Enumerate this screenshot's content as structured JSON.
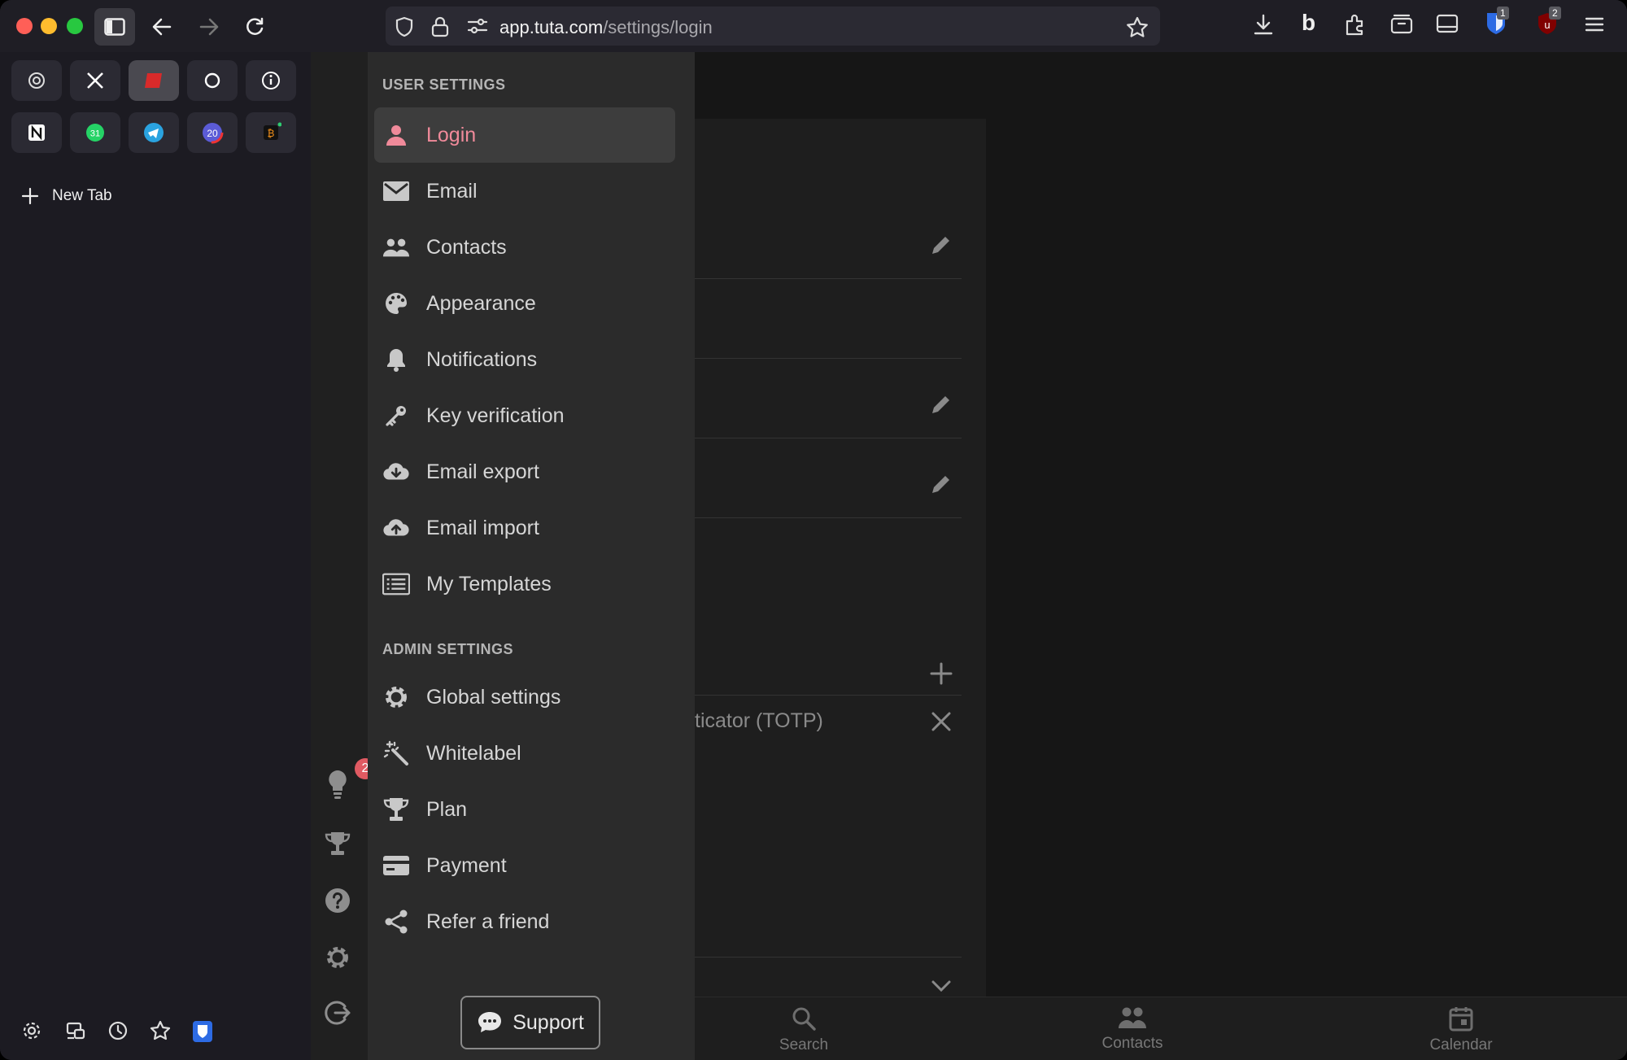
{
  "browser": {
    "url_domain": "app.tuta.com",
    "url_path": "/settings/login",
    "new_tab_label": "New Tab",
    "toolbar_badges": {
      "bitwarden": "1",
      "ublock": "2"
    }
  },
  "pinned_tabs": [
    {
      "name": "chatgpt"
    },
    {
      "name": "x"
    },
    {
      "name": "tuta"
    },
    {
      "name": "circle"
    },
    {
      "name": "info"
    },
    {
      "name": "notion"
    },
    {
      "name": "whatsapp"
    },
    {
      "name": "telegram"
    },
    {
      "name": "calendar"
    },
    {
      "name": "bitcoin"
    }
  ],
  "rail": {
    "notification_count": "2"
  },
  "settings_menu": {
    "user_section_title": "USER SETTINGS",
    "admin_section_title": "ADMIN SETTINGS",
    "user_items": [
      {
        "label": "Login",
        "icon": "person-icon",
        "selected": true
      },
      {
        "label": "Email",
        "icon": "envelope-icon"
      },
      {
        "label": "Contacts",
        "icon": "people-icon"
      },
      {
        "label": "Appearance",
        "icon": "palette-icon"
      },
      {
        "label": "Notifications",
        "icon": "bell-icon"
      },
      {
        "label": "Key verification",
        "icon": "key-icon"
      },
      {
        "label": "Email export",
        "icon": "cloud-download-icon"
      },
      {
        "label": "Email import",
        "icon": "cloud-upload-icon"
      },
      {
        "label": "My Templates",
        "icon": "list-icon"
      }
    ],
    "admin_items": [
      {
        "label": "Global settings",
        "icon": "gear-icon"
      },
      {
        "label": "Whitelabel",
        "icon": "magic-wand-icon"
      },
      {
        "label": "Plan",
        "icon": "trophy-icon"
      },
      {
        "label": "Payment",
        "icon": "credit-card-icon"
      },
      {
        "label": "Refer a friend",
        "icon": "share-icon"
      }
    ],
    "support_label": "Support"
  },
  "main": {
    "totp_text": "ticator (TOTP)"
  },
  "bottom_nav": {
    "search": "Search",
    "contacts": "Contacts",
    "calendar": "Calendar"
  },
  "colors": {
    "accent": "#f08a9a",
    "menu_bg": "#2b2b2b",
    "selected_bg": "#3d3d3d"
  }
}
